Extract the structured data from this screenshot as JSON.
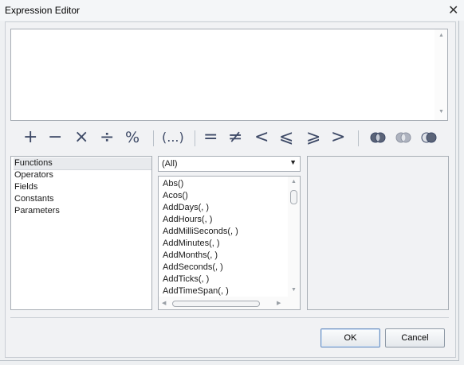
{
  "window": {
    "title": "Expression Editor",
    "close_glyph": "✕"
  },
  "editor": {
    "value": "",
    "scroll_up": "▲",
    "scroll_down": "▼"
  },
  "operators": [
    {
      "glyph": "+",
      "name": "plus-operator"
    },
    {
      "glyph": "−",
      "name": "minus-operator"
    },
    {
      "glyph": "×",
      "name": "multiply-operator"
    },
    {
      "glyph": "÷",
      "name": "divide-operator"
    },
    {
      "glyph": "%",
      "name": "modulo-operator"
    },
    {
      "glyph": "(...)",
      "name": "parentheses-operator"
    },
    {
      "glyph": "=",
      "name": "equals-operator"
    },
    {
      "glyph": "≠",
      "name": "not-equal-operator"
    },
    {
      "glyph": "<",
      "name": "less-than-operator"
    },
    {
      "glyph": "⩽",
      "name": "less-or-equal-operator"
    },
    {
      "glyph": "⩾",
      "name": "greater-or-equal-operator"
    },
    {
      "glyph": ">",
      "name": "greater-than-operator"
    }
  ],
  "logic_icons": [
    "and-venn-icon",
    "or-venn-icon",
    "not-venn-icon"
  ],
  "categories": {
    "items": [
      "Functions",
      "Operators",
      "Fields",
      "Constants",
      "Parameters"
    ],
    "selected": "Functions"
  },
  "filter": {
    "value": "(All)",
    "caret": "▼"
  },
  "functions": {
    "items": [
      "Abs()",
      "Acos()",
      "AddDays(, )",
      "AddHours(, )",
      "AddMilliSeconds(, )",
      "AddMinutes(, )",
      "AddMonths(, )",
      "AddSeconds(, )",
      "AddTicks(, )",
      "AddTimeSpan(, )"
    ],
    "scroll_up": "▲",
    "scroll_down": "▼",
    "scroll_left": "◀",
    "scroll_right": "▶"
  },
  "description": {
    "text": ""
  },
  "buttons": {
    "ok": "OK",
    "cancel": "Cancel"
  }
}
